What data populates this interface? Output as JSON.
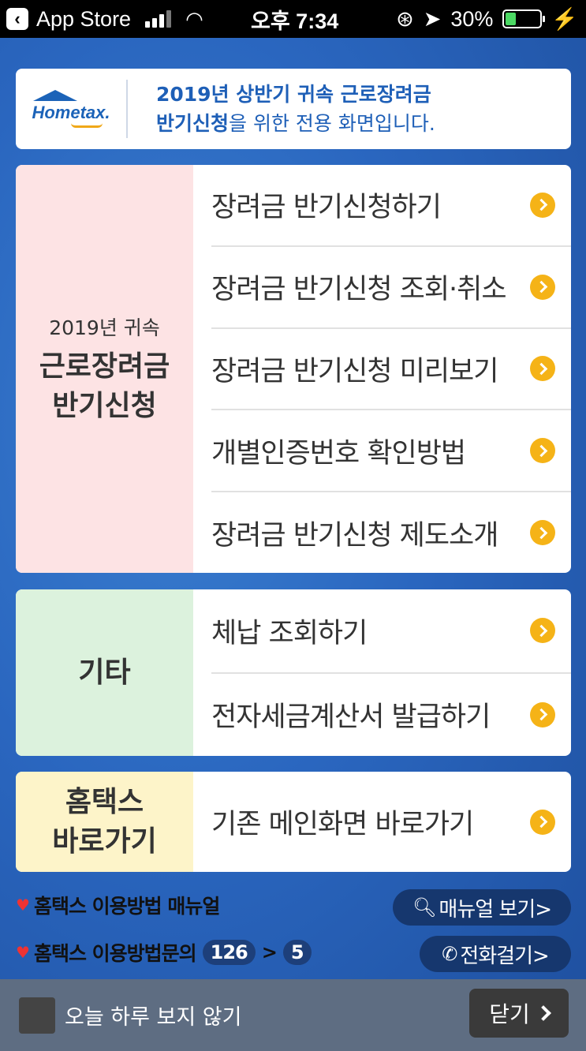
{
  "status_bar": {
    "back_app": "App Store",
    "time": "오후 7:34",
    "battery": "30%",
    "battery_level": 0.3
  },
  "header": {
    "logo_text": "Hometax.",
    "line1": "2019년 상반기 귀속 근로장려금",
    "line2_bold": "반기신청",
    "line2_rest": "을 위한 전용 화면입니다."
  },
  "sections": {
    "s1": {
      "label_small": "2019년 귀속",
      "label_line1": "근로장려금",
      "label_line2": "반기신청",
      "items": [
        "장려금 반기신청하기",
        "장려금 반기신청 조회·취소",
        "장려금 반기신청 미리보기",
        "개별인증번호 확인방법",
        "장려금 반기신청 제도소개"
      ]
    },
    "s2": {
      "label": "기타",
      "items": [
        "체납 조회하기",
        "전자세금계산서 발급하기"
      ]
    },
    "s3": {
      "label_line1": "홈택스",
      "label_line2": "바로가기",
      "items": [
        "기존 메인화면 바로가기"
      ]
    }
  },
  "info": {
    "manual_label": "홈택스 이용방법 매뉴얼",
    "manual_button": "매뉴얼 보기>",
    "contact_label": "홈택스 이용방법문의",
    "contact_num1": "126",
    "contact_sep": ">",
    "contact_num2": "5",
    "call_button": "전화걸기>"
  },
  "footer": {
    "checkbox_label": "오늘 하루 보지 않기",
    "close_label": "닫기"
  }
}
